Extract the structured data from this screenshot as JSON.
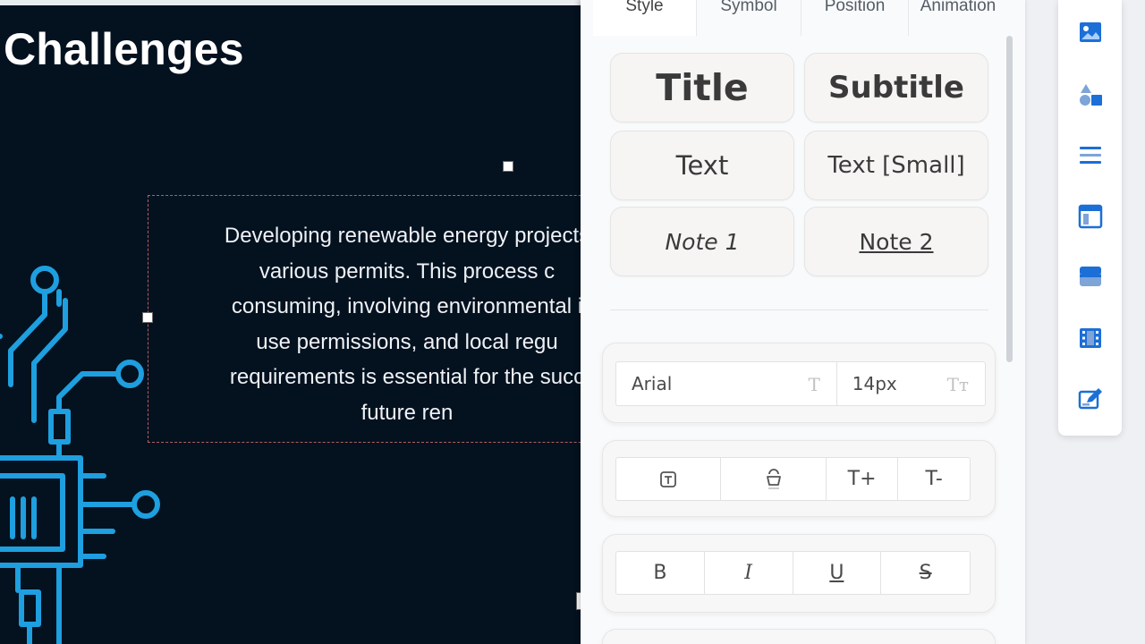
{
  "slide": {
    "title": "Challenges",
    "body_lines": [
      "Developing renewable energy projects",
      "various permits. This process c",
      "consuming, involving environmental i",
      "use permissions, and local regu",
      "requirements is essential for the succ",
      "future ren"
    ],
    "accent_color": "#1e9fdf",
    "background_color": "#04111f"
  },
  "panel": {
    "tabs": [
      {
        "label": "Style",
        "active": true
      },
      {
        "label": "Symbol",
        "active": false
      },
      {
        "label": "Position",
        "active": false
      },
      {
        "label": "Animation",
        "active": false
      }
    ],
    "styles": {
      "title": "Title",
      "subtitle": "Subtitle",
      "text": "Text",
      "text_small": "Text [Small]",
      "note1": "Note 1",
      "note2": "Note 2"
    },
    "font": {
      "family": "Arial",
      "size": "14px",
      "family_icon": "font-family-icon",
      "size_icon": "font-size-icon"
    },
    "tools": {
      "text_box_icon": "text-box-icon",
      "fill_icon": "paint-bucket-icon",
      "increase": "T+",
      "decrease": "T-"
    },
    "format": {
      "bold": "B",
      "italic": "I",
      "underline": "U",
      "strikethrough": "S"
    }
  },
  "rail": {
    "icons": [
      "image-icon",
      "shapes-icon",
      "text-lines-icon",
      "layout-icon",
      "card-icon",
      "film-icon",
      "edit-icon"
    ],
    "icon_color": "#1c6fd6"
  }
}
